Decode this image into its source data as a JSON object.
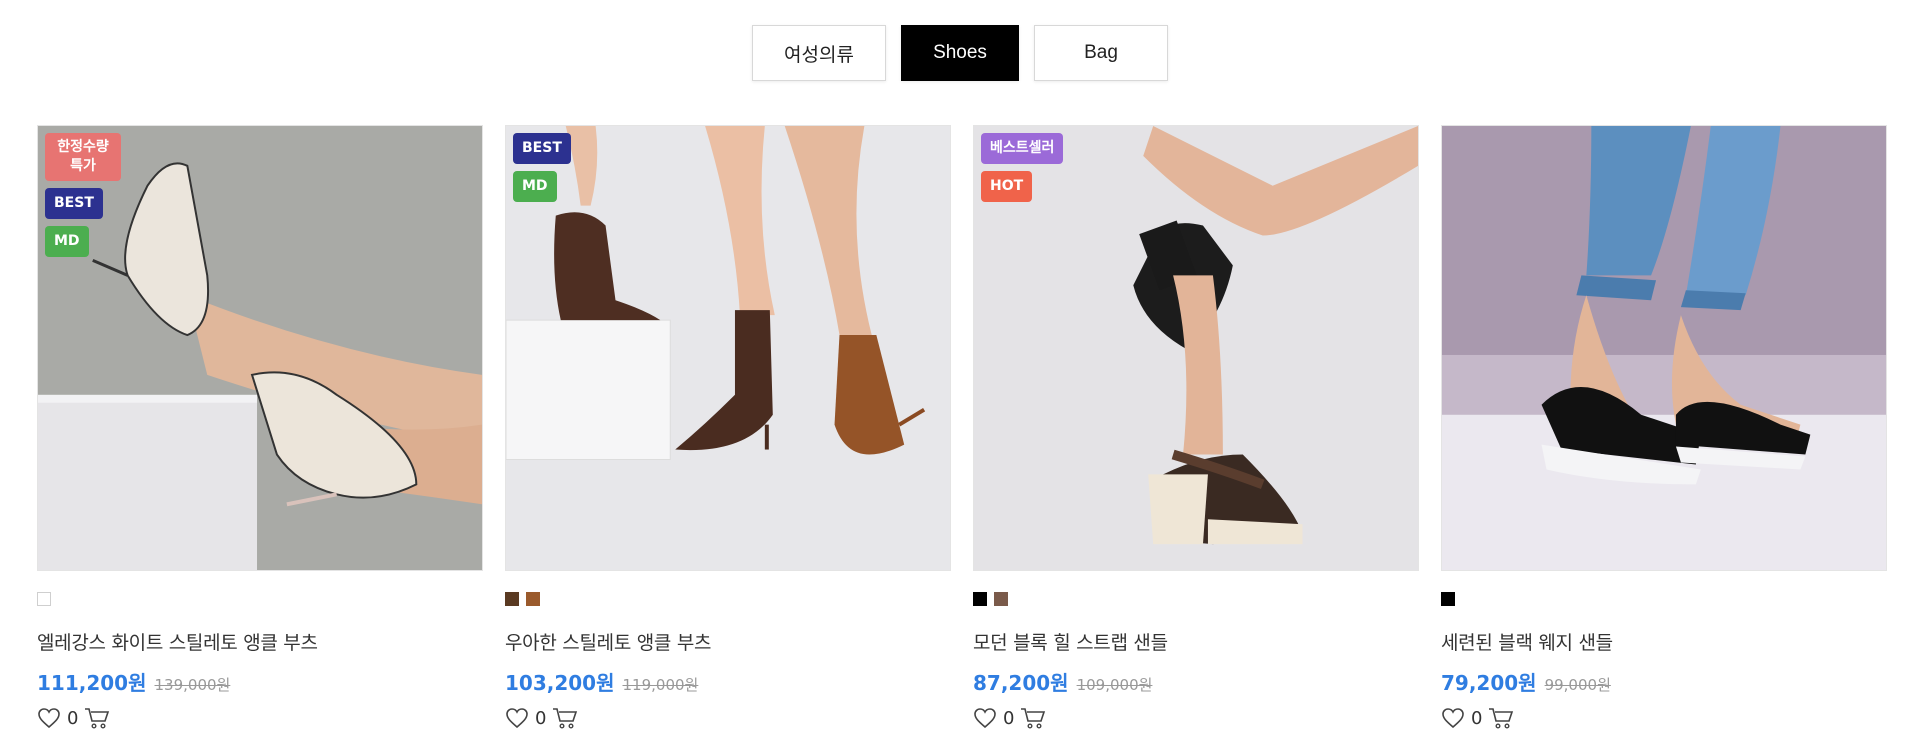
{
  "tabs": [
    {
      "label": "여성의류",
      "active": false
    },
    {
      "label": "Shoes",
      "active": true
    },
    {
      "label": "Bag",
      "active": false
    }
  ],
  "icons": {
    "like": "heart-icon",
    "cart": "cart-icon"
  },
  "colors": {
    "price": "#2f7de1",
    "best": "#2c3190",
    "md": "#4cae4f",
    "limited": "#e77472",
    "bestseller": "#9b6ad8",
    "hot": "#f0634a"
  },
  "products": [
    {
      "name": "엘레강스 화이트 스틸레토 앵클 부츠",
      "price": "111,200원",
      "original_price": "139,000원",
      "likes": "0",
      "badges": [
        {
          "type": "limited",
          "label": "한정수량\n특가"
        },
        {
          "type": "best",
          "label": "BEST"
        },
        {
          "type": "md",
          "label": "MD"
        }
      ],
      "swatches": [
        "#ffffff"
      ]
    },
    {
      "name": "우아한 스틸레토 앵클 부츠",
      "price": "103,200원",
      "original_price": "119,000원",
      "likes": "0",
      "badges": [
        {
          "type": "best",
          "label": "BEST"
        },
        {
          "type": "md",
          "label": "MD"
        }
      ],
      "swatches": [
        "#5a3a22",
        "#9a5a2c"
      ]
    },
    {
      "name": "모던 블록 힐 스트랩 샌들",
      "price": "87,200원",
      "original_price": "109,000원",
      "likes": "0",
      "badges": [
        {
          "type": "bestseller",
          "label": "베스트셀러"
        },
        {
          "type": "hot",
          "label": "HOT"
        }
      ],
      "swatches": [
        "#000000",
        "#7a5a4a"
      ]
    },
    {
      "name": "세련된 블랙 웨지 샌들",
      "price": "79,200원",
      "original_price": "99,000원",
      "likes": "0",
      "badges": [],
      "swatches": [
        "#000000"
      ]
    }
  ]
}
